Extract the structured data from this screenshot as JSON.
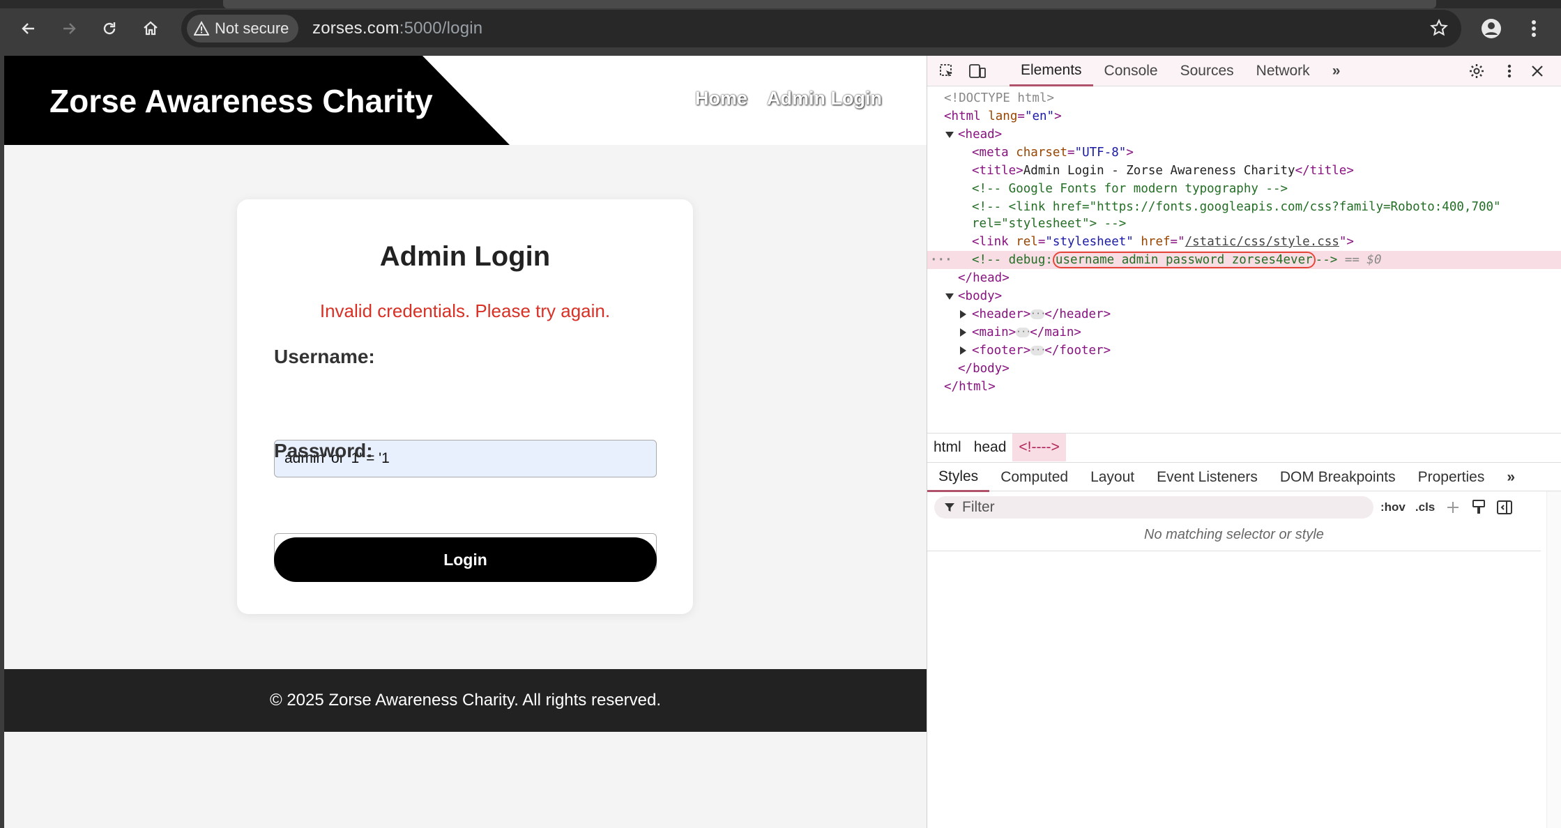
{
  "browser": {
    "security_label": "Not secure",
    "url_host": "zorses.com",
    "url_rest": ":5000/login"
  },
  "site": {
    "brand": "Zorse Awareness Charity",
    "nav": [
      "Home",
      "Admin Login"
    ],
    "login": {
      "title": "Admin Login",
      "error": "Invalid credentials. Please try again.",
      "username_label": "Username:",
      "username_value": "admin' or '1' = '1",
      "password_label": "Password:",
      "password_value": "•••••",
      "button": "Login"
    },
    "footer": "© 2025 Zorse Awareness Charity. All rights reserved."
  },
  "devtools": {
    "tabs": [
      "Elements",
      "Console",
      "Sources",
      "Network"
    ],
    "more_tabs": "»",
    "tree": {
      "doctype": "<!DOCTYPE html>",
      "html_open_tag": "<html",
      "html_lang_attr": "lang",
      "html_lang_val": "\"en\"",
      "head_open": "<head>",
      "meta_tag": "<meta",
      "meta_attr": "charset",
      "meta_val": "\"UTF-8\"",
      "title_open": "<title>",
      "title_text": "Admin Login - Zorse Awareness Charity",
      "title_close": "</title>",
      "comment_fonts": "<!-- Google Fonts for modern typography -->",
      "comment_link_1": "<!-- <link href=\"https://fonts.googleapis.com/css?family=Roboto:400,700\"",
      "comment_link_2": "rel=\"stylesheet\"> -->",
      "link_tag": "<link",
      "link_rel_attr": "rel",
      "link_rel_val": "\"stylesheet\"",
      "link_href_attr": "href",
      "link_href_val": "/static/css/style.css",
      "debug_prefix": "<!-- debug:",
      "debug_secret": "username admin password zorses4ever",
      "debug_suffix": "-->",
      "selected_marker": "== $0",
      "head_close": "</head>",
      "body_open": "<body>",
      "header_open": "<header>",
      "header_close": "</header>",
      "main_open": "<main>",
      "main_close": "</main>",
      "footer_open": "<footer>",
      "footer_close": "</footer>",
      "body_close": "</body>",
      "html_close": "</html>"
    },
    "breadcrumbs": [
      "html",
      "head",
      "<!---->"
    ],
    "subtabs": [
      "Styles",
      "Computed",
      "Layout",
      "Event Listeners",
      "DOM Breakpoints",
      "Properties"
    ],
    "filter_placeholder": "Filter",
    "hov": ":hov",
    "cls": ".cls",
    "no_match": "No matching selector or style"
  }
}
